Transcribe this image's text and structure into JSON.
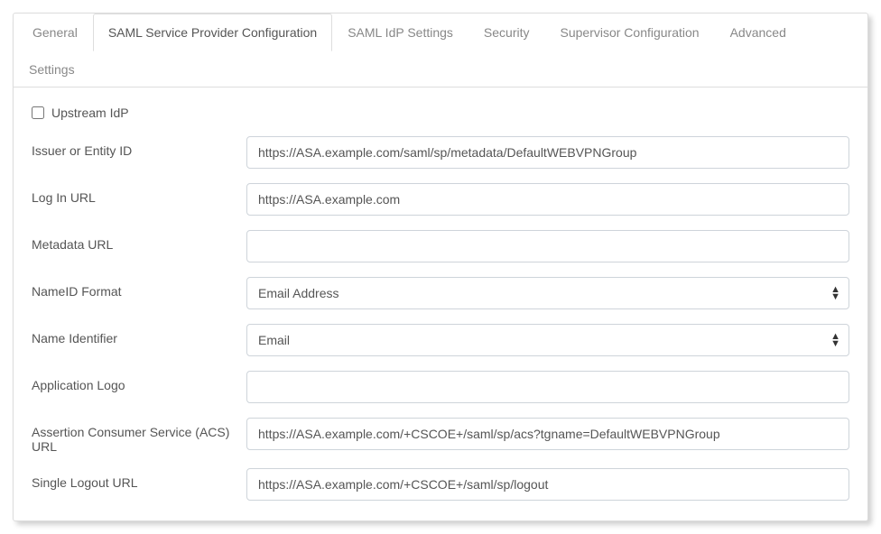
{
  "tabs": [
    {
      "label": "General",
      "active": false
    },
    {
      "label": "SAML Service Provider Configuration",
      "active": true
    },
    {
      "label": "SAML IdP Settings",
      "active": false
    },
    {
      "label": "Security",
      "active": false
    },
    {
      "label": "Supervisor Configuration",
      "active": false
    },
    {
      "label": "Advanced",
      "active": false
    },
    {
      "label": "Settings",
      "active": false
    }
  ],
  "form": {
    "upstream_idp": {
      "label": "Upstream IdP",
      "checked": false
    },
    "issuer": {
      "label": "Issuer or Entity ID",
      "value": "https://ASA.example.com/saml/sp/metadata/DefaultWEBVPNGroup"
    },
    "login_url": {
      "label": "Log In URL",
      "value": "https://ASA.example.com"
    },
    "metadata_url": {
      "label": "Metadata URL",
      "value": ""
    },
    "nameid_format": {
      "label": "NameID Format",
      "value": "Email Address"
    },
    "name_identifier": {
      "label": "Name Identifier",
      "value": "Email"
    },
    "app_logo": {
      "label": "Application Logo",
      "value": ""
    },
    "acs_url": {
      "label": "Assertion Consumer Service (ACS) URL",
      "value": "https://ASA.example.com/+CSCOE+/saml/sp/acs?tgname=DefaultWEBVPNGroup"
    },
    "slo_url": {
      "label": "Single Logout URL",
      "value": "https://ASA.example.com/+CSCOE+/saml/sp/logout"
    }
  }
}
